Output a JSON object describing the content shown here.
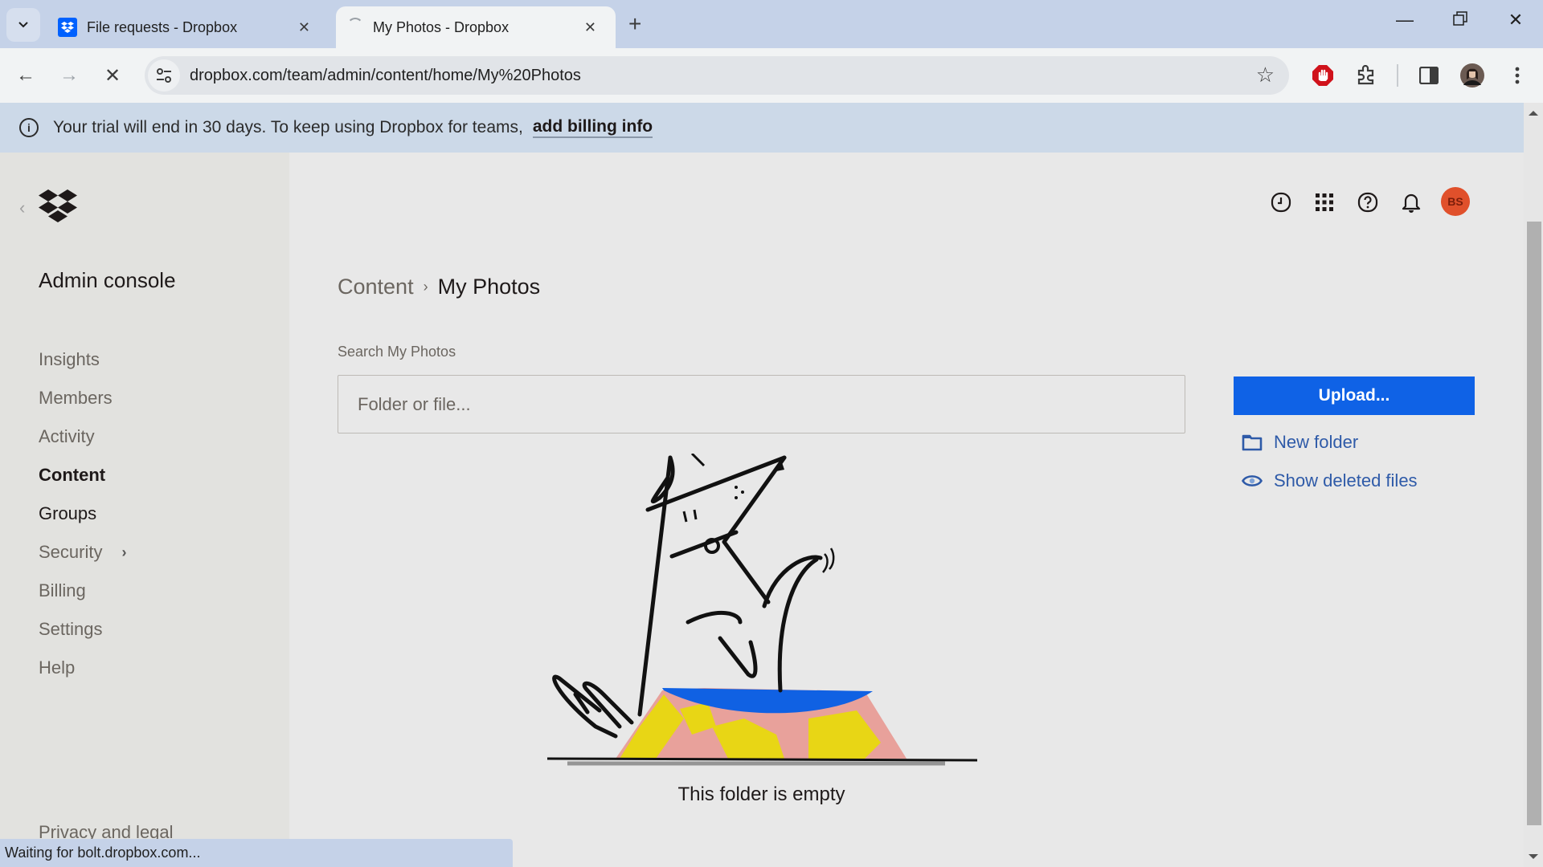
{
  "browser": {
    "tabs": [
      {
        "title": "File requests - Dropbox",
        "active": false,
        "icon": "dropbox-favicon"
      },
      {
        "title": "My Photos - Dropbox",
        "active": true,
        "icon": "loading-spinner"
      }
    ],
    "url": "dropbox.com/team/admin/content/home/My%20Photos",
    "status_text": "Waiting for bolt.dropbox.com..."
  },
  "banner": {
    "message": "Your trial will end in 30 days. To keep using Dropbox for teams,",
    "link_label": "add billing info",
    "icon": "info-icon"
  },
  "sidebar": {
    "title": "Admin console",
    "items": [
      {
        "label": "Insights",
        "active": false
      },
      {
        "label": "Members",
        "active": false
      },
      {
        "label": "Activity",
        "active": false
      },
      {
        "label": "Content",
        "active": true
      },
      {
        "label": "Groups",
        "active": false
      },
      {
        "label": "Security",
        "active": false,
        "has_submenu": true
      },
      {
        "label": "Billing",
        "active": false
      },
      {
        "label": "Settings",
        "active": false
      },
      {
        "label": "Help",
        "active": false
      }
    ],
    "footer_link": "Privacy and legal"
  },
  "header": {
    "icons": [
      "activity-clock-icon",
      "app-grid-icon",
      "help-icon",
      "notifications-bell-icon"
    ],
    "avatar_initials": "BS",
    "avatar_color": "#e0502b"
  },
  "main": {
    "breadcrumb": {
      "parent": "Content",
      "current": "My Photos"
    },
    "search": {
      "label": "Search My Photos",
      "placeholder": "Folder or file...",
      "value": ""
    },
    "actions": {
      "upload_label": "Upload...",
      "new_folder_label": "New folder",
      "show_deleted_label": "Show deleted files"
    },
    "empty_state": "This folder is empty"
  },
  "colors": {
    "accent": "#0f62e6",
    "link": "#2e5aa8",
    "banner_bg": "#ccd9e8",
    "sidebar_bg": "#e2e2df"
  }
}
